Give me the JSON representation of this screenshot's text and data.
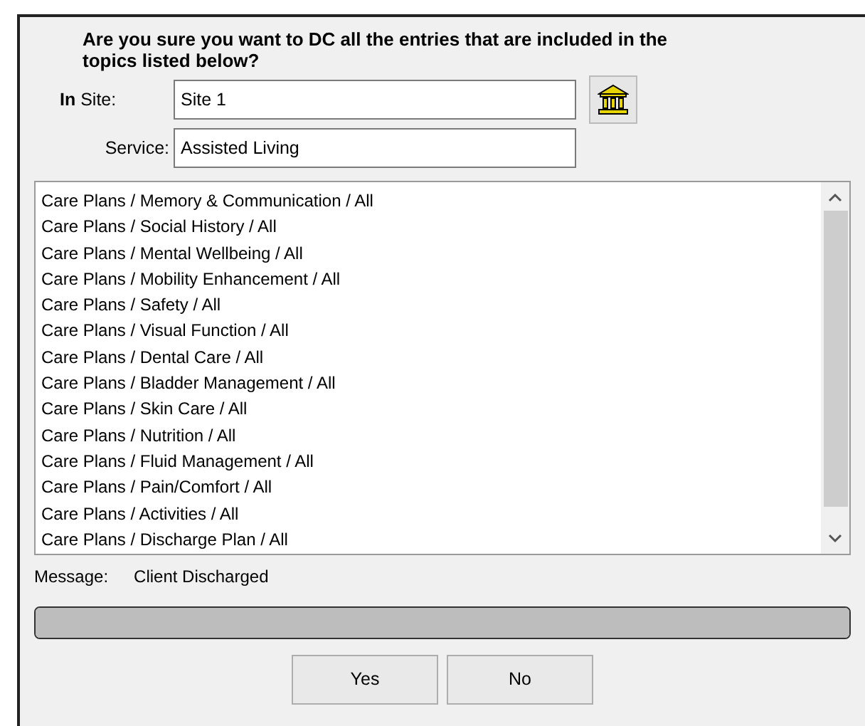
{
  "dialog": {
    "question": "Are you sure you want to DC all the entries that are included in the topics listed below?",
    "site": {
      "label": "**In** Site:",
      "value": "Site 1"
    },
    "service": {
      "label": "Service:",
      "value": "Assisted Living"
    },
    "topics": [
      "Care Plans / Memory & Communication / All",
      "Care Plans / Social History / All",
      "Care Plans / Mental Wellbeing / All",
      "Care Plans / Mobility Enhancement / All",
      "Care Plans / Safety / All",
      "Care Plans / Visual Function / All",
      "Care Plans / Dental Care / All",
      "Care Plans / Bladder Management / All",
      "Care Plans / Skin Care / All",
      "Care Plans / Nutrition / All",
      "Care Plans / Fluid Management / All",
      "Care Plans / Pain/Comfort / All",
      "Care Plans / Activities / All",
      "Care Plans / Discharge Plan / All"
    ],
    "message": {
      "label": "Message:",
      "value": "Client Discharged"
    },
    "progress": {
      "level": 1
    },
    "buttons": [
      "Yes",
      "No"
    ]
  }
}
